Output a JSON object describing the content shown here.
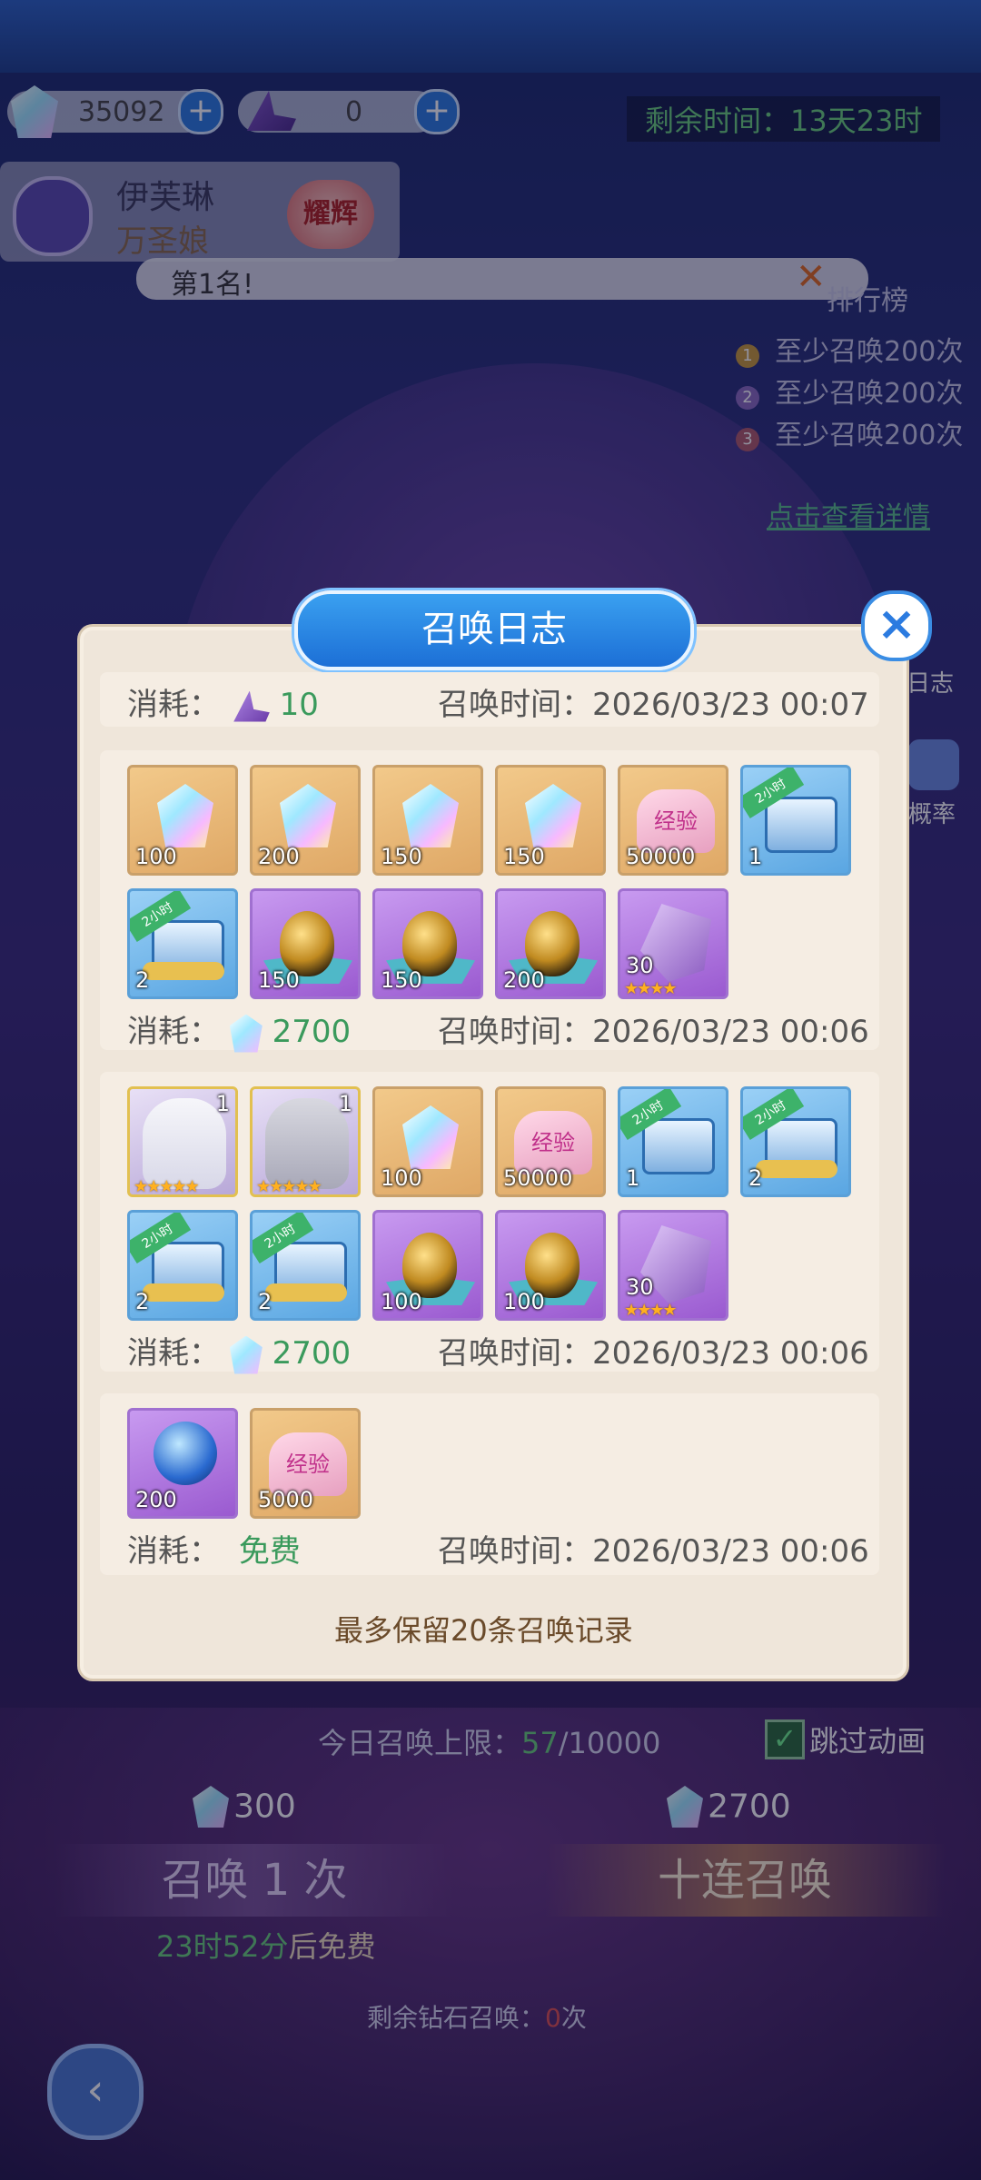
{
  "resources": {
    "gems": "35092",
    "tickets": "0"
  },
  "remaining_time": "剩余时间：13天23时",
  "character": {
    "name": "伊芙琳",
    "subtitle": "万圣娘",
    "badge": "耀辉"
  },
  "notice": {
    "text": "第1名!"
  },
  "leaderboard": {
    "title": "排行榜",
    "items": [
      {
        "rank": "1",
        "text": "至少召唤200次"
      },
      {
        "rank": "2",
        "text": "至少召唤200次"
      },
      {
        "rank": "3",
        "text": "至少召唤200次"
      }
    ],
    "link": "点击查看详情"
  },
  "side_buttons": {
    "log": "日志",
    "rates": "概率"
  },
  "modal": {
    "title": "召唤日志",
    "close_icon": "close-icon",
    "footer": "最多保留20条召唤记录",
    "records": [
      {
        "cost_label": "消耗：",
        "cost_value": "10",
        "cost_icon": "witch-hat-icon",
        "time_label": "召唤时间：",
        "time": "2026/03/23 00:07",
        "items": []
      },
      {
        "cost_label": "消耗：",
        "cost_value": "2700",
        "cost_icon": "gem-icon",
        "time_label": "召唤时间：",
        "time": "2026/03/23 00:06",
        "items": [
          {
            "type": "gem",
            "count": "100"
          },
          {
            "type": "gem",
            "count": "200"
          },
          {
            "type": "gem",
            "count": "150"
          },
          {
            "type": "gem",
            "count": "150"
          },
          {
            "type": "exp",
            "count": "50000",
            "label": "经验"
          },
          {
            "type": "chest",
            "count": "1",
            "ribbon": "2小时"
          },
          {
            "type": "chest-coin",
            "count": "2",
            "ribbon": "2小时"
          },
          {
            "type": "egg",
            "count": "150"
          },
          {
            "type": "egg",
            "count": "150"
          },
          {
            "type": "egg",
            "count": "200"
          },
          {
            "type": "shard",
            "count": "30",
            "stars": "★★★★"
          }
        ]
      },
      {
        "cost_label": "消耗：",
        "cost_value": "2700",
        "cost_icon": "gem-icon",
        "time_label": "召唤时间：",
        "time": "2026/03/23 00:06",
        "items": [
          {
            "type": "char",
            "count": "1",
            "stars": "★★★★★"
          },
          {
            "type": "char",
            "count": "1",
            "stars": "★★★★★"
          },
          {
            "type": "gem",
            "count": "100"
          },
          {
            "type": "exp",
            "count": "50000",
            "label": "经验"
          },
          {
            "type": "chest",
            "count": "1",
            "ribbon": "2小时"
          },
          {
            "type": "chest-coin",
            "count": "2",
            "ribbon": "2小时"
          },
          {
            "type": "chest-coin",
            "count": "2",
            "ribbon": "2小时"
          },
          {
            "type": "chest-coin",
            "count": "2",
            "ribbon": "2小时"
          },
          {
            "type": "egg",
            "count": "100"
          },
          {
            "type": "egg",
            "count": "100"
          },
          {
            "type": "shard",
            "count": "30",
            "stars": "★★★★"
          }
        ]
      },
      {
        "cost_label": "消耗：",
        "cost_value": "免费",
        "cost_icon": "",
        "time_label": "召唤时间：",
        "time": "2026/03/23 00:06",
        "items": [
          {
            "type": "orb",
            "count": "200"
          },
          {
            "type": "exp",
            "count": "5000",
            "label": "经验"
          }
        ]
      }
    ]
  },
  "bottom": {
    "daily_limit_label": "今日召唤上限：",
    "daily_limit_current": "57",
    "daily_limit_max": "/10000",
    "skip_label": "跳过动画",
    "single_price": "300",
    "ten_price": "2700",
    "single_label": "召唤 1 次",
    "ten_label": "十连召唤",
    "free_timer": "23时52分",
    "free_suffix": "后免费",
    "remaining_label": "剩余钻石召唤：",
    "remaining_value": "0",
    "remaining_unit": "次"
  }
}
